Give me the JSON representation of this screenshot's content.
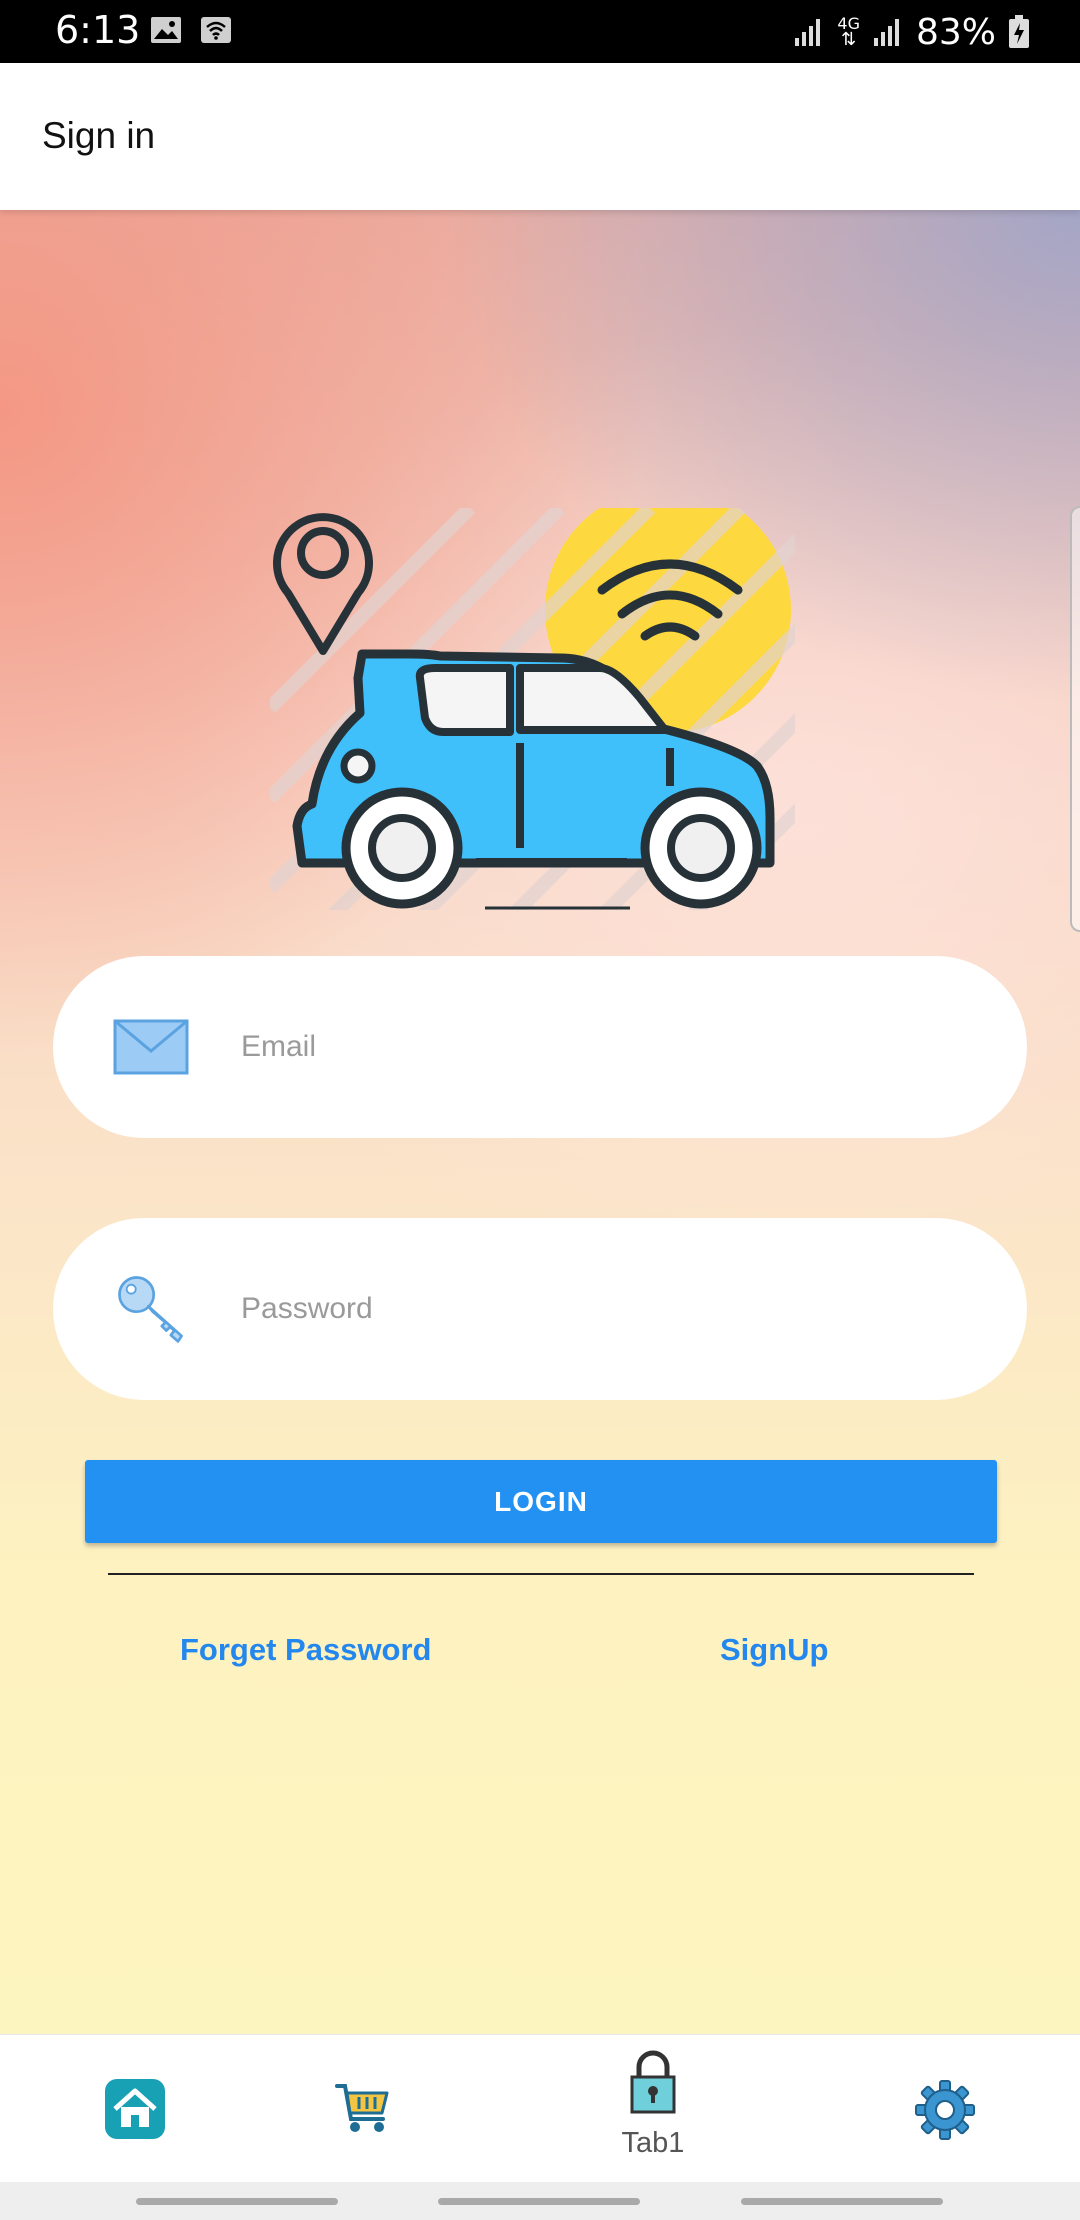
{
  "status_bar": {
    "time": "6:13",
    "network": "4G",
    "battery": "83%"
  },
  "header": {
    "title": "Sign in"
  },
  "form": {
    "email_placeholder": "Email",
    "password_placeholder": "Password",
    "login_label": "LOGIN",
    "forget_password_label": "Forget Password",
    "signup_label": "SignUp"
  },
  "bottom_nav": {
    "tabs": [
      {
        "icon": "home-icon",
        "label": ""
      },
      {
        "icon": "cart-icon",
        "label": ""
      },
      {
        "icon": "lock-icon",
        "label": "Tab1"
      },
      {
        "icon": "gear-icon",
        "label": ""
      }
    ]
  },
  "colors": {
    "accent": "#2291f2",
    "link": "#2487ee",
    "car_body": "#40c0fb",
    "sun": "#fed83f"
  }
}
